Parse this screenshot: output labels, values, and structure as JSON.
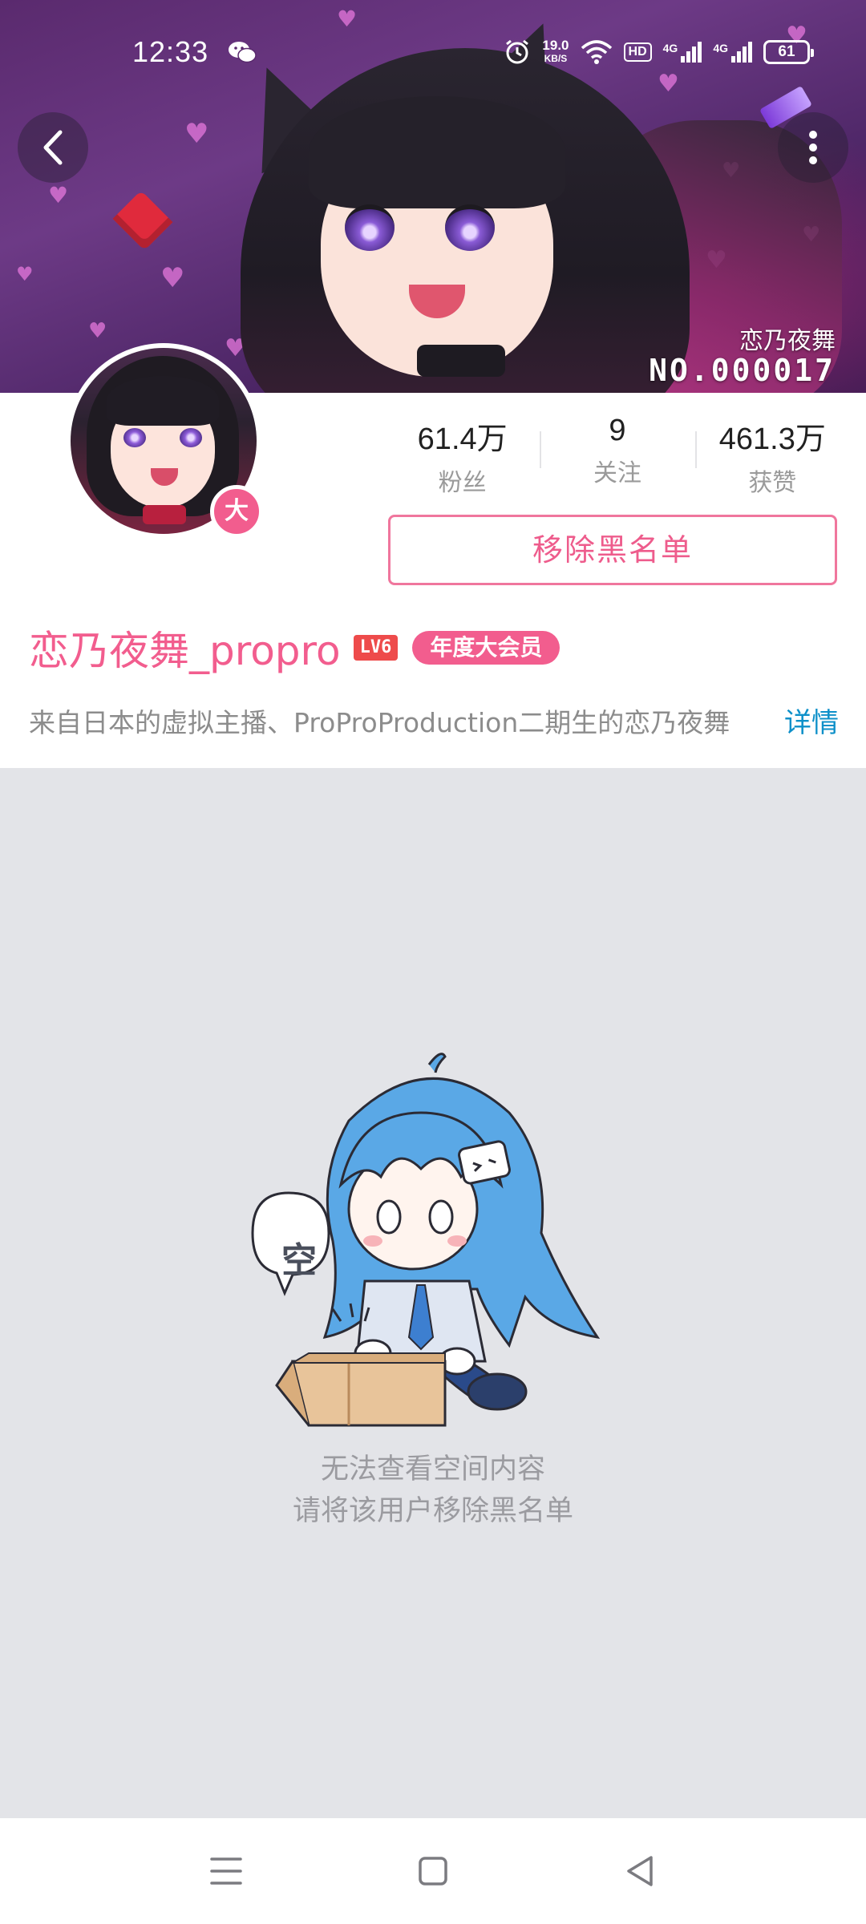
{
  "status_bar": {
    "time": "12:33",
    "net_speed_value": "19.0",
    "net_speed_unit": "KB/S",
    "hd_label": "HD",
    "sim1_label": "4G",
    "sim2_label": "4G",
    "battery": "61"
  },
  "banner": {
    "name": "恋乃夜舞",
    "number": "NO.000017"
  },
  "profile": {
    "vip_badge": "大",
    "stats": [
      {
        "value": "61.4万",
        "label": "粉丝"
      },
      {
        "value": "9",
        "label": "关注"
      },
      {
        "value": "461.3万",
        "label": "获赞"
      }
    ],
    "unblock_button": "移除黑名单",
    "username": "恋乃夜舞_propro",
    "level": "LV6",
    "vip_tag": "年度大会员",
    "bio": "来自日本的虚拟主播、ProProProduction二期生的恋乃夜舞",
    "details_link": "详情"
  },
  "empty_state": {
    "bubble_text": "空",
    "line1": "无法查看空间内容",
    "line2": "请将该用户移除黑名单"
  },
  "colors": {
    "accent_pink": "#f25d8e",
    "link_blue": "#0e90c9",
    "background_gray": "#e3e4e8"
  },
  "icons": [
    "back-arrow-icon",
    "more-vertical-icon",
    "wechat-icon",
    "alarm-icon",
    "wifi-icon",
    "menu-icon",
    "home-square-icon",
    "back-triangle-icon"
  ]
}
